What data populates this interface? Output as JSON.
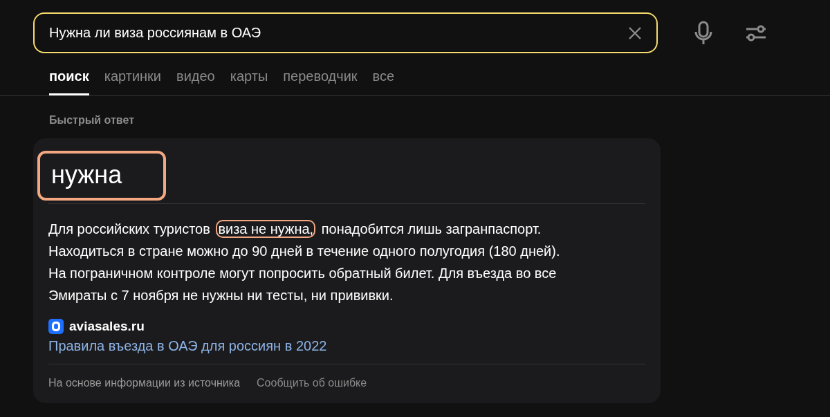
{
  "search": {
    "value": "Нужна ли виза россиянам в ОАЭ"
  },
  "tabs": [
    {
      "label": "поиск",
      "selected": true
    },
    {
      "label": "картинки",
      "selected": false
    },
    {
      "label": "видео",
      "selected": false
    },
    {
      "label": "карты",
      "selected": false
    },
    {
      "label": "переводчик",
      "selected": false
    },
    {
      "label": "все",
      "selected": false
    }
  ],
  "section_title": "Быстрый ответ",
  "answer": {
    "headline": "нужна",
    "headline_circled": true,
    "lines": [
      [
        {
          "text": "Для российских туристов ",
          "circled": false
        },
        {
          "text": "виза не нужна,",
          "circled": true
        },
        {
          "text": " понадобится лишь загранпаспорт.",
          "circled": false
        }
      ],
      [
        {
          "text": "Находиться в стране можно до 90 дней в течение одного полугодия (180 дней).",
          "circled": false
        }
      ],
      [
        {
          "text": "На пограничном контроле могут попросить обратный билет. Для въезда во все",
          "circled": false
        }
      ],
      [
        {
          "text": "Эмираты с 7 ноября не нужны ни тесты, ни прививки.",
          "circled": false
        }
      ]
    ],
    "source": "aviasales.ru",
    "link": "Правила въезда в ОАЭ для россиян в 2022",
    "footer_note": "На основе информации из источника",
    "report_link": "Сообщить об ошибке"
  }
}
